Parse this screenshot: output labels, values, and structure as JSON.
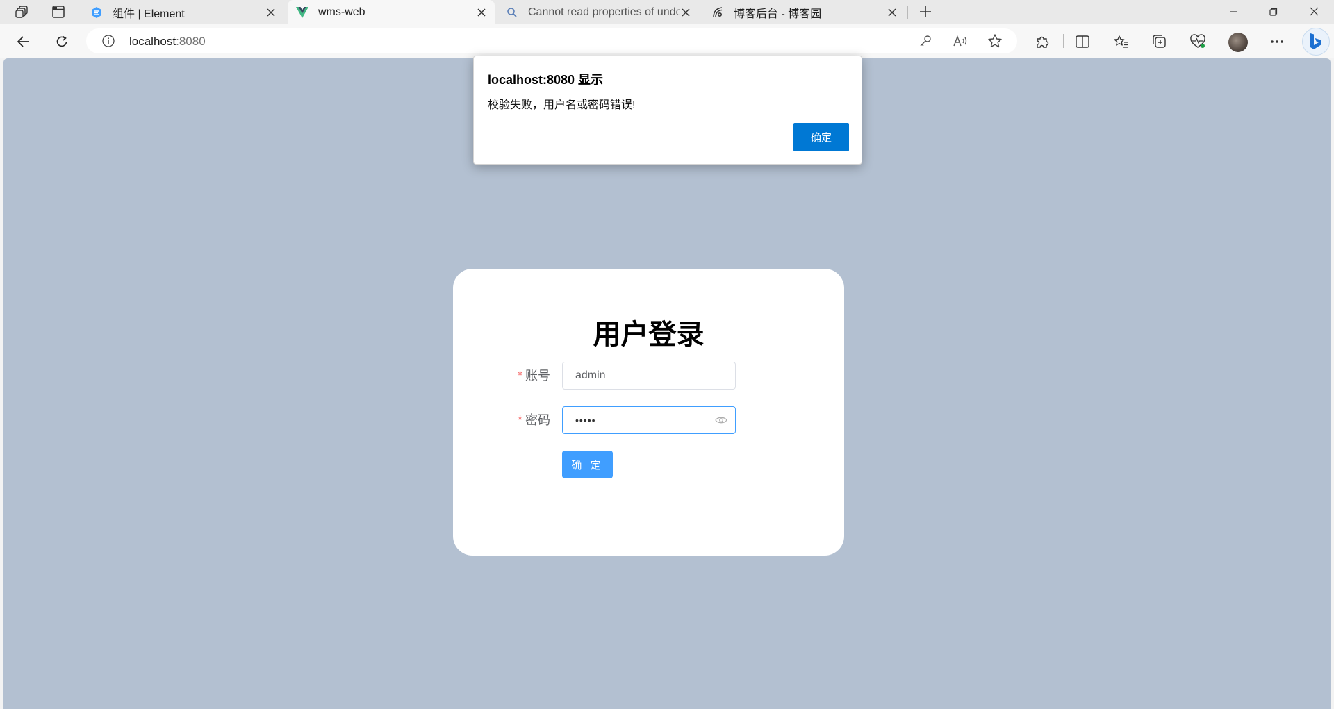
{
  "tabs": [
    {
      "title": "组件 | Element",
      "icon": "element-logo-icon"
    },
    {
      "title": "wms-web",
      "icon": "vue-logo-icon",
      "active": true
    },
    {
      "title": "Cannot read properties of undefi",
      "icon": "search-icon"
    },
    {
      "title": "博客后台 - 博客园",
      "icon": "cnblogs-logo-icon"
    }
  ],
  "address": {
    "host": "localhost",
    "port": ":8080"
  },
  "login": {
    "title": "用户登录",
    "username_label": "账号",
    "password_label": "密码",
    "required_mark": "*",
    "username_value": "admin",
    "password_mask": "•••••",
    "submit_label": "确 定"
  },
  "dialog": {
    "title": "localhost:8080 显示",
    "message": "校验失败，用户名或密码错误!",
    "ok_label": "确定"
  },
  "colors": {
    "page_bg": "#b3c0d1",
    "primary": "#409eff",
    "dialog_button": "#0078d4",
    "required": "#f56c6c"
  }
}
